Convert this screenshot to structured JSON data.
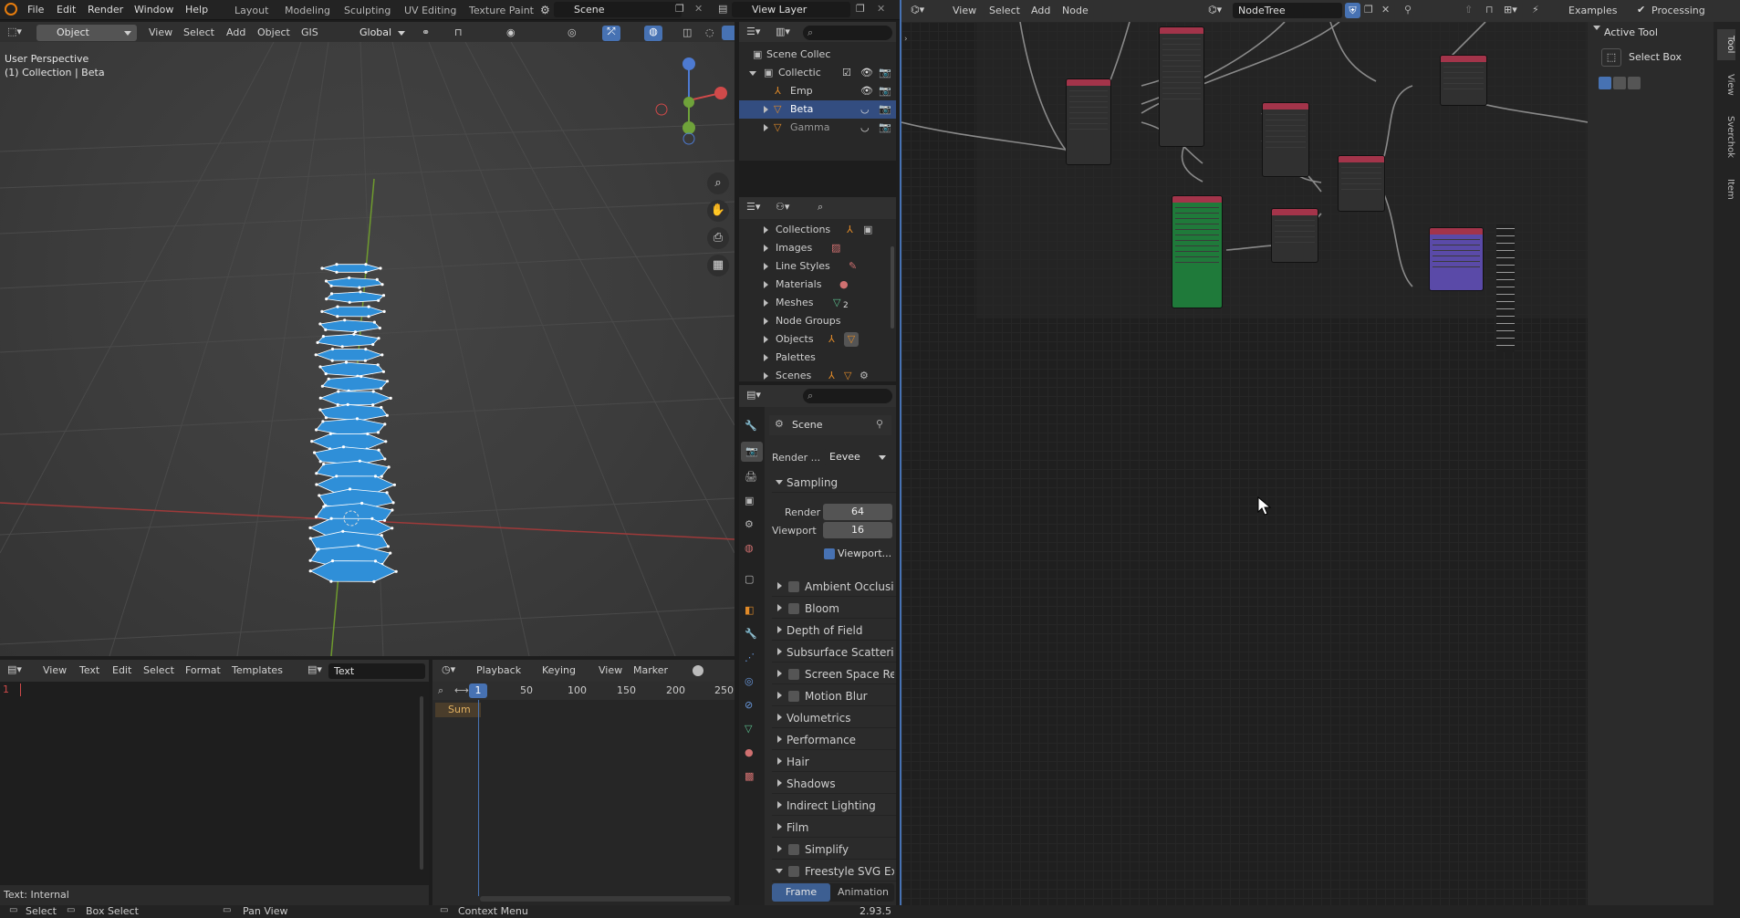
{
  "menubar": {
    "items": [
      "File",
      "Edit",
      "Render",
      "Window",
      "Help"
    ]
  },
  "workspaces": [
    "Layout",
    "Modeling",
    "Sculpting",
    "UV Editing",
    "Texture Paint"
  ],
  "scene_field": "Scene",
  "view_layer_field": "View Layer",
  "viewport": {
    "header": {
      "mode": "Object Mode",
      "menus": [
        "View",
        "Select",
        "Add",
        "Object",
        "GIS"
      ],
      "transform": "Global"
    },
    "overlay_title": "User Perspective",
    "overlay_subtitle": "(1) Collection | Beta"
  },
  "text_editor": {
    "menus": [
      "View",
      "Text",
      "Edit",
      "Select",
      "Format",
      "Templates"
    ],
    "datablock": "Text",
    "line_number": "1",
    "footer": "Text: Internal"
  },
  "timeline": {
    "menus": [
      "Playback",
      "Keying",
      "View",
      "Marker"
    ],
    "current_frame": "1",
    "ticks": [
      "50",
      "100",
      "150",
      "200",
      "250"
    ],
    "track": "Sum"
  },
  "outliner": {
    "root": "Scene Collec",
    "items": [
      {
        "label": "Collectic"
      },
      {
        "label": "Emp"
      },
      {
        "label": "Beta"
      },
      {
        "label": "Gamma"
      }
    ]
  },
  "datablocks": {
    "items": [
      "Collections",
      "Images",
      "Line Styles",
      "Materials",
      "Meshes",
      "Node Groups",
      "Objects",
      "Palettes",
      "Scenes"
    ],
    "mesh_badge": "2"
  },
  "properties": {
    "scene_label": "Scene",
    "render_engine_label": "Render ...",
    "render_engine": "Eevee",
    "sampling_label": "Sampling",
    "render_label": "Render",
    "render_value": "64",
    "viewport_label": "Viewport",
    "viewport_value": "16",
    "viewport_denoise": "Viewport...",
    "panels": [
      {
        "label": "Ambient Occlusion",
        "check": true
      },
      {
        "label": "Bloom",
        "check": true
      },
      {
        "label": "Depth of Field",
        "check": false
      },
      {
        "label": "Subsurface Scattering",
        "check": false
      },
      {
        "label": "Screen Space Refle",
        "check": true
      },
      {
        "label": "Motion Blur",
        "check": true
      },
      {
        "label": "Volumetrics",
        "check": false
      },
      {
        "label": "Performance",
        "check": false
      },
      {
        "label": "Hair",
        "check": false
      },
      {
        "label": "Shadows",
        "check": false
      },
      {
        "label": "Indirect Lighting",
        "check": false
      },
      {
        "label": "Film",
        "check": false
      },
      {
        "label": "Simplify",
        "check": true
      },
      {
        "label": "Freestyle SVG Expo",
        "check": true
      }
    ],
    "tabs": [
      "Frame",
      "Animation"
    ]
  },
  "node_editor": {
    "menus": [
      "View",
      "Select",
      "Add",
      "Node"
    ],
    "tree_name": "NodeTree",
    "examples": "Examples",
    "processing": "Processing"
  },
  "tool_panel": {
    "section": "Active Tool",
    "tool": "Select Box",
    "tabs": [
      "Tool",
      "View",
      "Sverchok",
      "Item"
    ]
  },
  "statusbar": {
    "select": "Select",
    "box_select": "Box Select",
    "pan_view": "Pan View",
    "context_menu": "Context Menu",
    "version": "2.93.5"
  },
  "colors": {
    "accent": "#4772b3",
    "selected_row": "#334d80",
    "mesh_fill": "#2f8fd8",
    "node_header_red": "#a3344a",
    "node_green": "#1f7a3a",
    "node_purple": "#5a4aa8"
  }
}
